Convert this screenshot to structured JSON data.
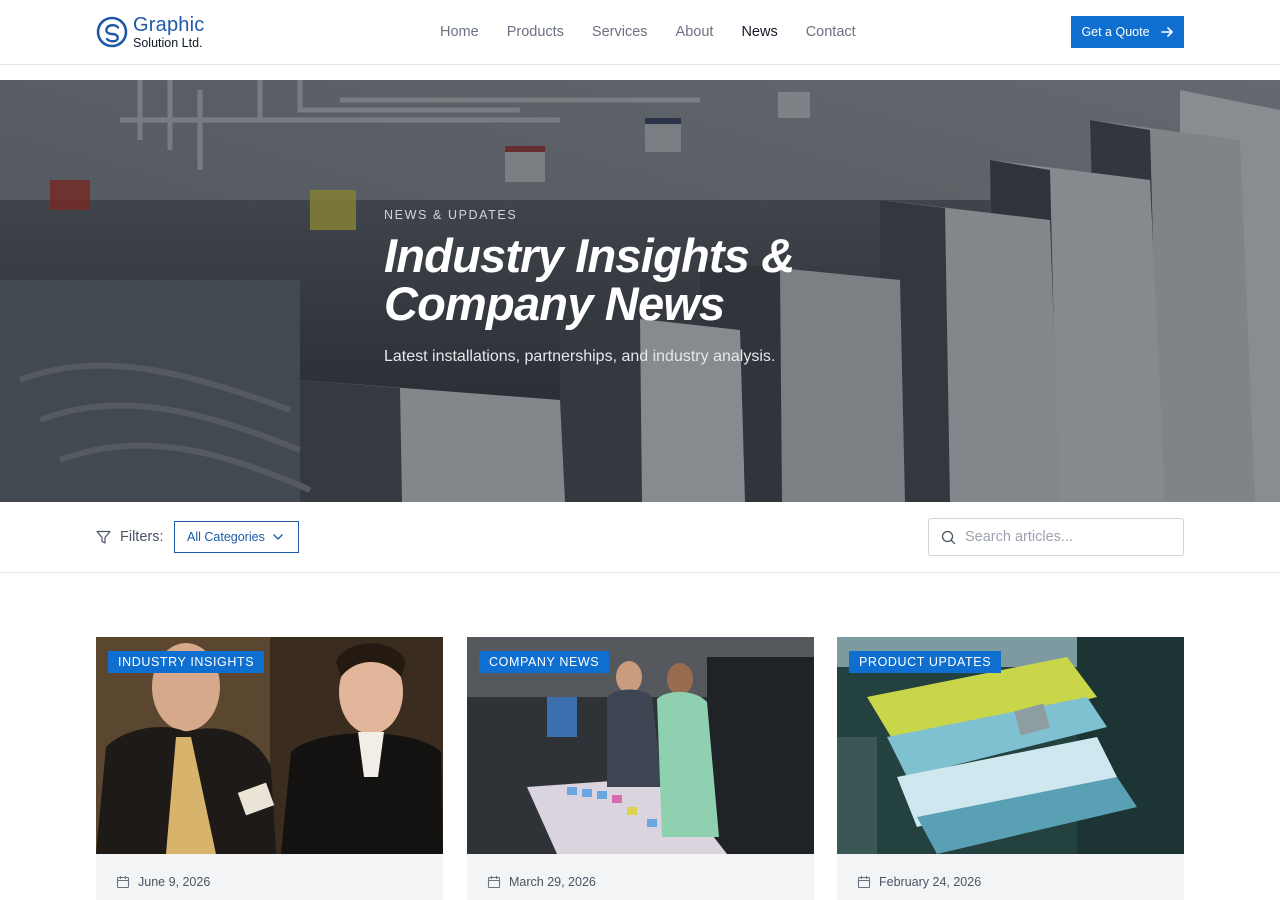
{
  "brand": {
    "name_line1": "Graphic",
    "name_line2": "Solution Ltd.",
    "icon": "logo-mark-icon"
  },
  "nav": [
    {
      "label": "Home",
      "active": false
    },
    {
      "label": "Products",
      "active": false
    },
    {
      "label": "Services",
      "active": false
    },
    {
      "label": "About",
      "active": false
    },
    {
      "label": "News",
      "active": true
    },
    {
      "label": "Contact",
      "active": false
    }
  ],
  "cta": {
    "label": "Get a Quote",
    "icon": "arrow-right-icon"
  },
  "hero": {
    "eyebrow": "NEWS & UPDATES",
    "title_line1": "Industry Insights &",
    "title_line2": "Company News",
    "subtitle": "Latest installations, partnerships, and industry analysis."
  },
  "filters": {
    "label": "Filters:",
    "category_selected": "All Categories",
    "search_placeholder": "Search articles..."
  },
  "articles": [
    {
      "category": "INDUSTRY INSIGHTS",
      "date": "June 9, 2026"
    },
    {
      "category": "COMPANY NEWS",
      "date": "March 29, 2026"
    },
    {
      "category": "PRODUCT UPDATES",
      "date": "February 24, 2026"
    }
  ],
  "colors": {
    "accent": "#0f6fd0",
    "brand_blue": "#1e5aa8",
    "card_bg": "#f3f4f6"
  }
}
